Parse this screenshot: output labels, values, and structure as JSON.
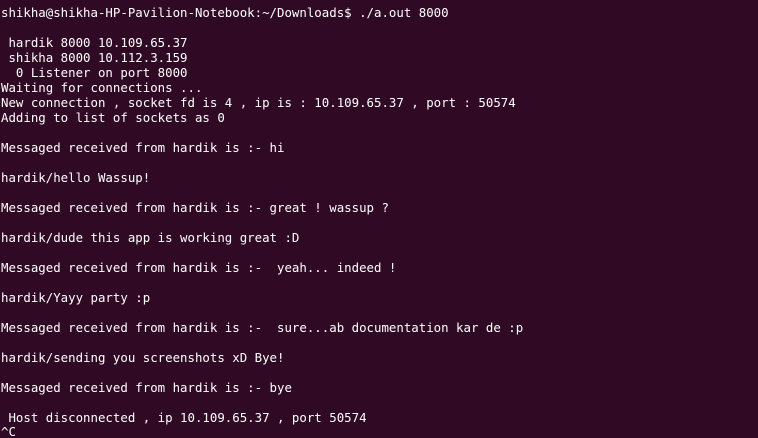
{
  "terminal": {
    "lines": [
      "shikha@shikha-HP-Pavilion-Notebook:~/Downloads$ ./a.out 8000",
      "",
      " hardik 8000 10.109.65.37",
      " shikha 8000 10.112.3.159",
      "  0 Listener on port 8000",
      "Waiting for connections ...",
      "New connection , socket fd is 4 , ip is : 10.109.65.37 , port : 50574",
      "Adding to list of sockets as 0",
      "",
      "Messaged received from hardik is :- hi",
      "",
      "hardik/hello Wassup!",
      "",
      "Messaged received from hardik is :- great ! wassup ?",
      "",
      "hardik/dude this app is working great :D",
      "",
      "Messaged received from hardik is :-  yeah... indeed !",
      "",
      "hardik/Yayy party :p",
      "",
      "Messaged received from hardik is :-  sure...ab documentation kar de :p",
      "",
      "hardik/sending you screenshots xD Bye!",
      "",
      "Messaged received from hardik is :- bye",
      "",
      " Host disconnected , ip 10.109.65.37 , port 50574",
      "^C"
    ]
  }
}
